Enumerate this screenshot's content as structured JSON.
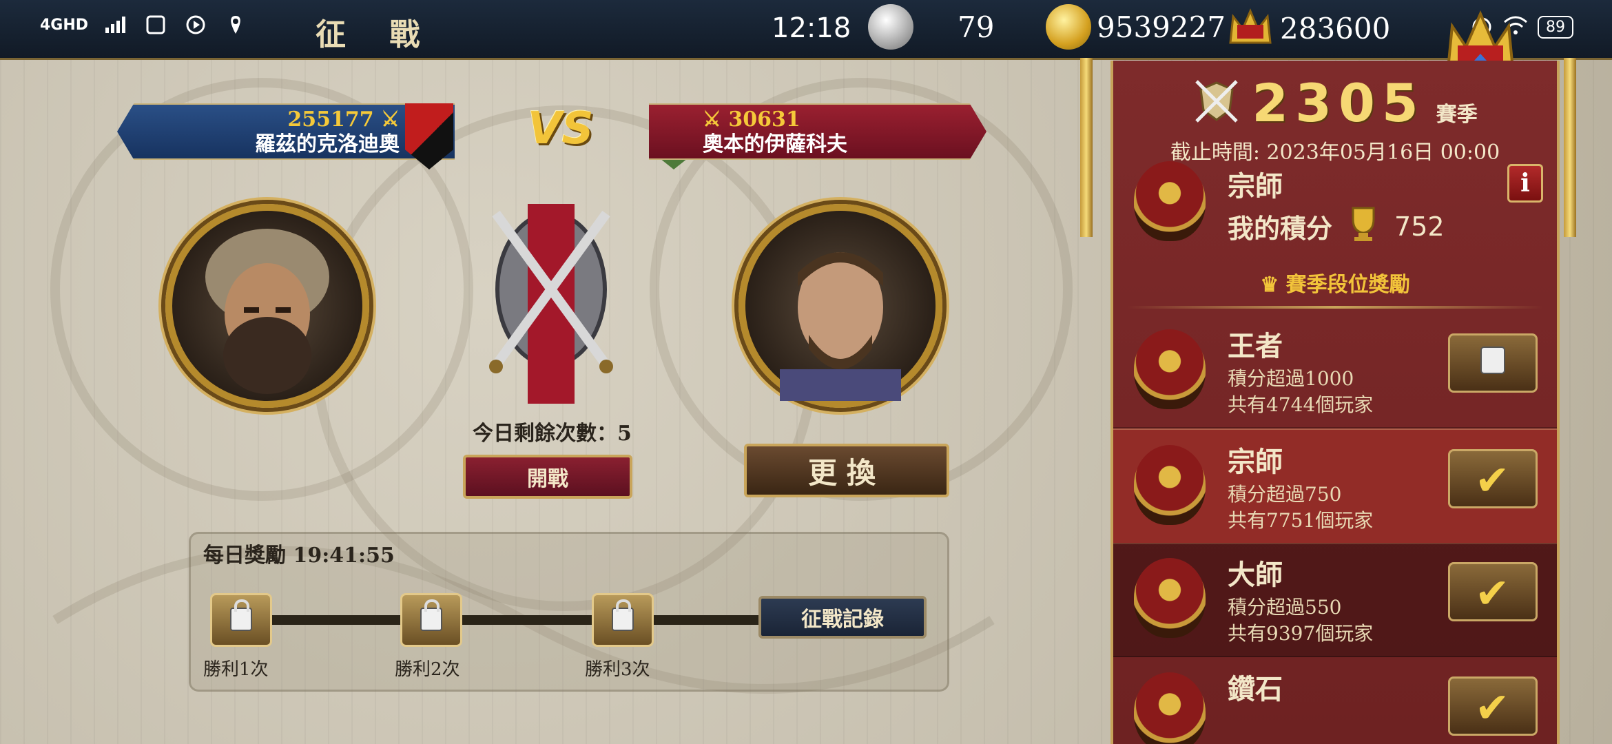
{
  "status_bar": {
    "network": "4GHD",
    "time": "12:18",
    "battery": "89"
  },
  "header": {
    "title": "征 戰",
    "silver_count": "79",
    "gold_count": "9539227",
    "crown_count": "283600"
  },
  "player_left": {
    "score": "255177",
    "name": "羅茲的克洛迪奧"
  },
  "vs_label": "VS",
  "player_right": {
    "score": "30631",
    "name": "奧本的伊薩科夫"
  },
  "remaining_attempts": "今日剩餘次數：5",
  "buttons": {
    "start_battle": "開戰",
    "change": "更換",
    "battle_log": "征戰記錄"
  },
  "daily_reward": {
    "title": "每日獎勵 19:41:55",
    "milestones": [
      "勝利1次",
      "勝利2次",
      "勝利3次"
    ]
  },
  "season_panel": {
    "season_number": "2305",
    "season_label": "賽季",
    "deadline": "截止時間: 2023年05月16日 00:00",
    "current_rank": "宗師",
    "my_points_label": "我的積分",
    "my_points": "752",
    "info_label": "i",
    "rewards_header": "賽季段位獎勵",
    "ranks": [
      {
        "name": "王者",
        "requirement": "積分超過1000",
        "players": "共有4744個玩家",
        "state": "locked"
      },
      {
        "name": "宗師",
        "requirement": "積分超過750",
        "players": "共有7751個玩家",
        "state": "claimed"
      },
      {
        "name": "大師",
        "requirement": "積分超過550",
        "players": "共有9397個玩家",
        "state": "claimed"
      },
      {
        "name": "鑽石",
        "requirement": "",
        "players": "",
        "state": "claimed"
      }
    ]
  },
  "colors": {
    "gold": "#f2c43a",
    "panel_red": "#7e2b2b",
    "left_banner": "#2a4f86",
    "right_banner": "#9a2030"
  }
}
